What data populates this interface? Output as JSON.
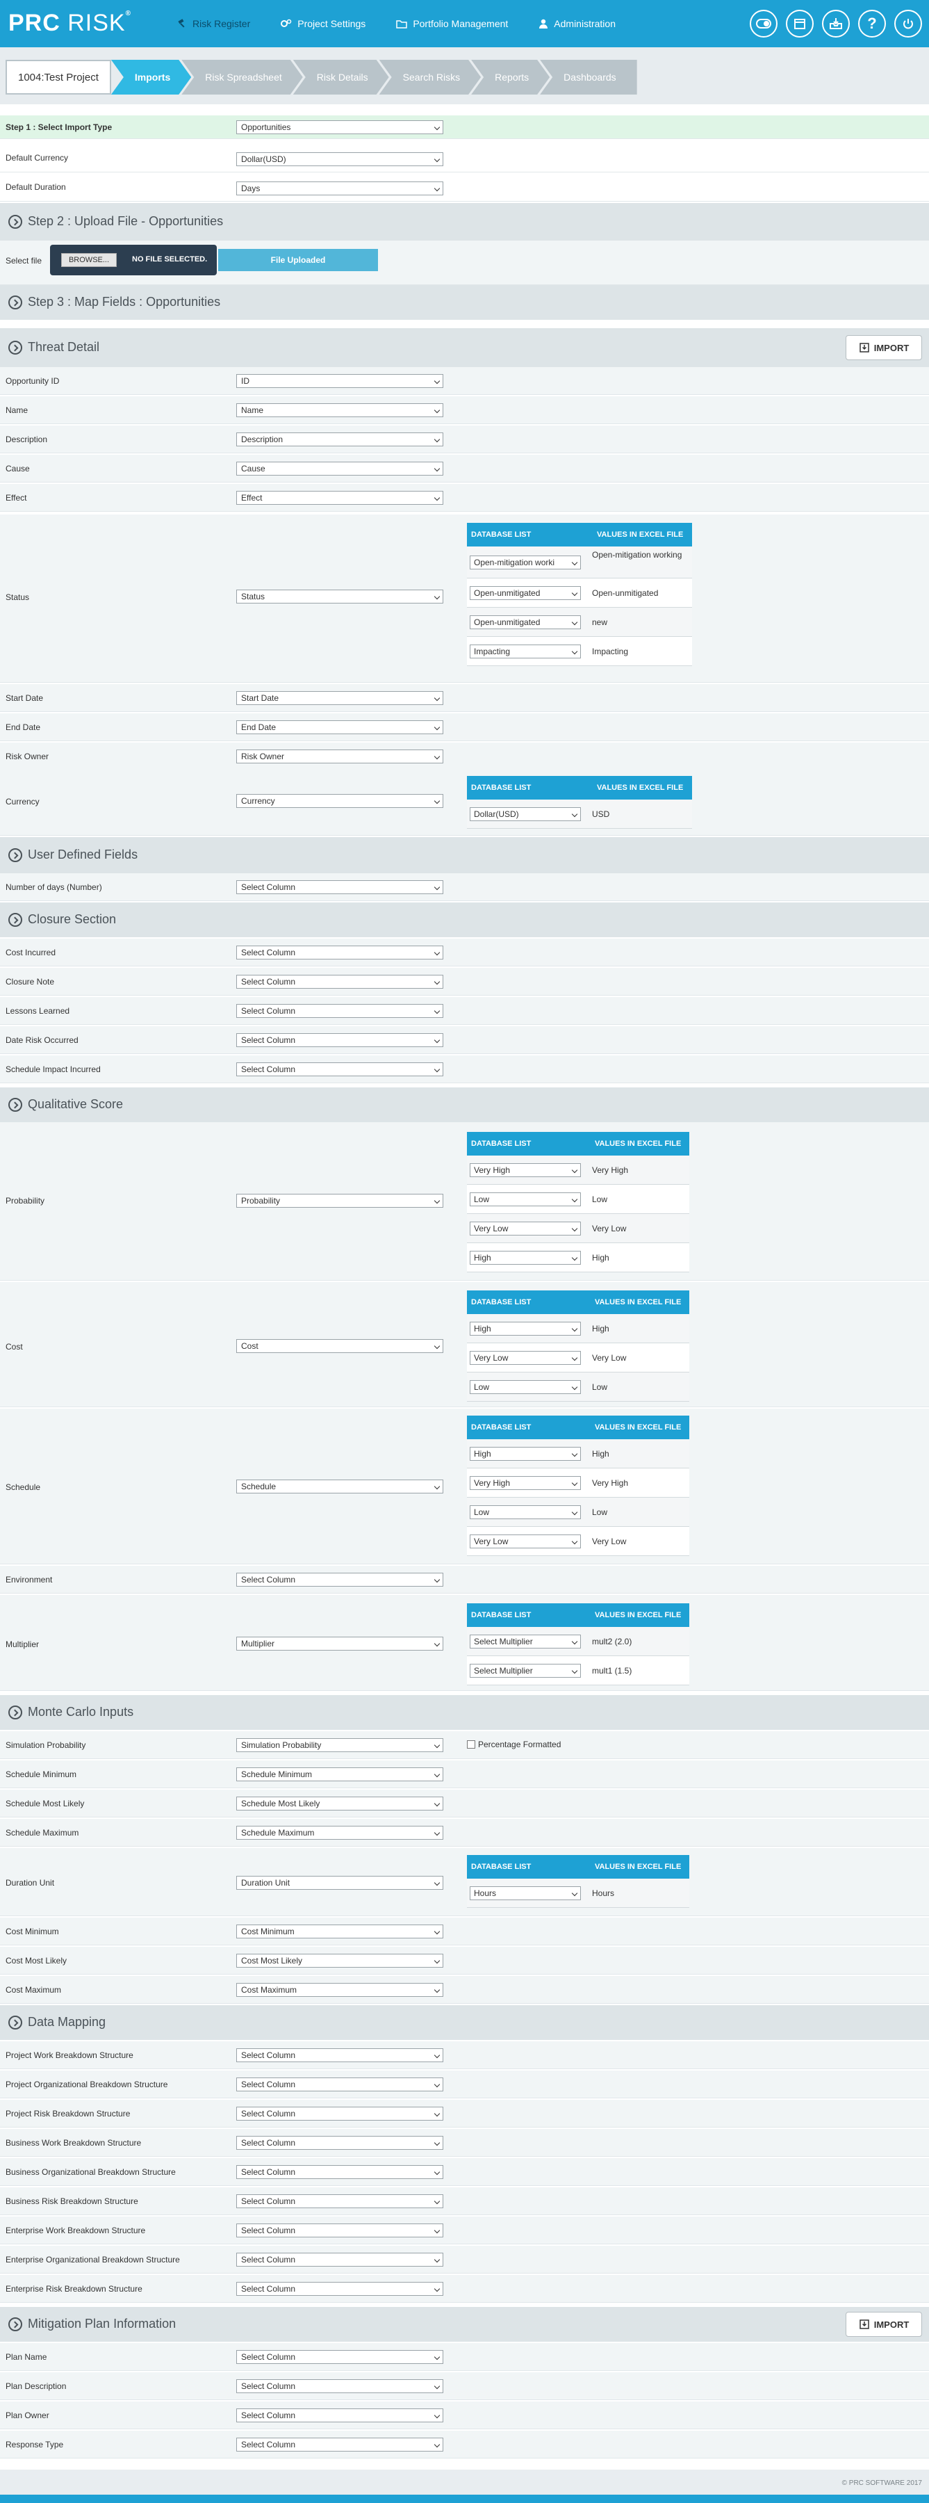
{
  "app": {
    "logo_main": "PRC",
    "logo_sub": "RISK",
    "logo_mark": "®"
  },
  "nav": {
    "items": [
      {
        "label": "Risk Register",
        "icon": "gavel-icon"
      },
      {
        "label": "Project Settings",
        "icon": "gear-icon"
      },
      {
        "label": "Portfolio Management",
        "icon": "folder-icon"
      },
      {
        "label": "Administration",
        "icon": "user-icon"
      }
    ]
  },
  "topicons": [
    "toggle-icon",
    "calendar-icon",
    "inbox-icon",
    "help-icon",
    "power-icon"
  ],
  "breadcrumb": {
    "project": "1004:Test Project",
    "tabs": [
      "Imports",
      "Risk Spreadsheet",
      "Risk Details",
      "Search Risks",
      "Reports",
      "Dashboards"
    ]
  },
  "step1": {
    "label": "Step 1 : Select Import Type",
    "value": "Opportunities",
    "currency_label": "Default Currency",
    "currency_value": "Dollar(USD)",
    "duration_label": "Default Duration",
    "duration_value": "Days"
  },
  "step2": {
    "title": "Step 2 : Upload File - Opportunities",
    "select_file": "Select file",
    "browse": "BROWSE...",
    "no_file": "NO FILE SELECTED.",
    "uploaded": "File Uploaded"
  },
  "step3": {
    "title": "Step 3 : Map Fields : Opportunities"
  },
  "map_headers": {
    "db": "DATABASE LIST",
    "excel": "VALUES IN EXCEL FILE"
  },
  "import_label": "IMPORT",
  "threat": {
    "title": "Threat Detail",
    "fields": [
      {
        "label": "Opportunity ID",
        "value": "ID"
      },
      {
        "label": "Name",
        "value": "Name"
      },
      {
        "label": "Description",
        "value": "Description"
      },
      {
        "label": "Cause",
        "value": "Cause"
      },
      {
        "label": "Effect",
        "value": "Effect"
      }
    ],
    "status": {
      "label": "Status",
      "value": "Status",
      "map": [
        {
          "db": "Open-mitigation worki",
          "excel": "Open-mitigation working"
        },
        {
          "db": "Open-unmitigated",
          "excel": "Open-unmitigated"
        },
        {
          "db": "Open-unmitigated",
          "excel": "new"
        },
        {
          "db": "Impacting",
          "excel": "Impacting"
        }
      ]
    },
    "fields2": [
      {
        "label": "Start Date",
        "value": "Start Date"
      },
      {
        "label": "End Date",
        "value": "End Date"
      },
      {
        "label": "Risk Owner",
        "value": "Risk Owner"
      }
    ],
    "currency": {
      "label": "Currency",
      "value": "Currency",
      "map": [
        {
          "db": "Dollar(USD)",
          "excel": "USD"
        }
      ]
    }
  },
  "udf": {
    "title": "User Defined Fields",
    "fields": [
      {
        "label": "Number of days (Number)",
        "value": "Select Column"
      }
    ]
  },
  "closure": {
    "title": "Closure Section",
    "fields": [
      {
        "label": "Cost Incurred",
        "value": "Select Column"
      },
      {
        "label": "Closure Note",
        "value": "Select Column"
      },
      {
        "label": "Lessons Learned",
        "value": "Select Column"
      },
      {
        "label": "Date Risk Occurred",
        "value": "Select Column"
      },
      {
        "label": "Schedule Impact Incurred",
        "value": "Select Column"
      }
    ]
  },
  "qual": {
    "title": "Qualitative Score",
    "probability": {
      "label": "Probability",
      "value": "Probability",
      "map": [
        {
          "db": "Very High",
          "excel": "Very High"
        },
        {
          "db": "Low",
          "excel": "Low"
        },
        {
          "db": "Very Low",
          "excel": "Very Low"
        },
        {
          "db": "High",
          "excel": "High"
        }
      ]
    },
    "cost": {
      "label": "Cost",
      "value": "Cost",
      "map": [
        {
          "db": "High",
          "excel": "High"
        },
        {
          "db": "Very Low",
          "excel": "Very Low"
        },
        {
          "db": "Low",
          "excel": "Low"
        }
      ]
    },
    "schedule": {
      "label": "Schedule",
      "value": "Schedule",
      "map": [
        {
          "db": "High",
          "excel": "High"
        },
        {
          "db": "Very High",
          "excel": "Very High"
        },
        {
          "db": "Low",
          "excel": "Low"
        },
        {
          "db": "Very Low",
          "excel": "Very Low"
        }
      ]
    },
    "environment": {
      "label": "Environment",
      "value": "Select Column"
    },
    "multiplier": {
      "label": "Multiplier",
      "value": "Multiplier",
      "map": [
        {
          "db": "Select Multiplier",
          "excel": "mult2 (2.0)"
        },
        {
          "db": "Select Multiplier",
          "excel": "mult1 (1.5)"
        }
      ]
    }
  },
  "monte": {
    "title": "Monte Carlo Inputs",
    "sim": {
      "label": "Simulation Probability",
      "value": "Simulation Probability",
      "checkbox": "Percentage Formatted"
    },
    "fields": [
      {
        "label": "Schedule Minimum",
        "value": "Schedule Minimum"
      },
      {
        "label": "Schedule Most Likely",
        "value": "Schedule Most Likely"
      },
      {
        "label": "Schedule Maximum",
        "value": "Schedule Maximum"
      }
    ],
    "duration": {
      "label": "Duration Unit",
      "value": "Duration Unit",
      "map": [
        {
          "db": "Hours",
          "excel": "Hours"
        }
      ]
    },
    "fields2": [
      {
        "label": "Cost Minimum",
        "value": "Cost Minimum"
      },
      {
        "label": "Cost Most Likely",
        "value": "Cost Most Likely"
      },
      {
        "label": "Cost Maximum",
        "value": "Cost Maximum"
      }
    ]
  },
  "datamap": {
    "title": "Data Mapping",
    "fields": [
      {
        "label": "Project Work Breakdown Structure",
        "value": "Select Column"
      },
      {
        "label": "Project Organizational Breakdown Structure",
        "value": "Select Column"
      },
      {
        "label": "Project Risk Breakdown Structure",
        "value": "Select Column"
      },
      {
        "label": "Business Work Breakdown Structure",
        "value": "Select Column"
      },
      {
        "label": "Business Organizational Breakdown Structure",
        "value": "Select Column"
      },
      {
        "label": "Business Risk Breakdown Structure",
        "value": "Select Column"
      },
      {
        "label": "Enterprise Work Breakdown Structure",
        "value": "Select Column"
      },
      {
        "label": "Enterprise Organizational Breakdown Structure",
        "value": "Select Column"
      },
      {
        "label": "Enterprise Risk Breakdown Structure",
        "value": "Select Column"
      }
    ]
  },
  "mitigation": {
    "title": "Mitigation Plan Information",
    "fields": [
      {
        "label": "Plan Name",
        "value": "Select Column"
      },
      {
        "label": "Plan Description",
        "value": "Select Column"
      },
      {
        "label": "Plan Owner",
        "value": "Select Column"
      },
      {
        "label": "Response Type",
        "value": "Select Column"
      }
    ]
  },
  "footer": {
    "copyright": "© PRC SOFTWARE 2017"
  }
}
